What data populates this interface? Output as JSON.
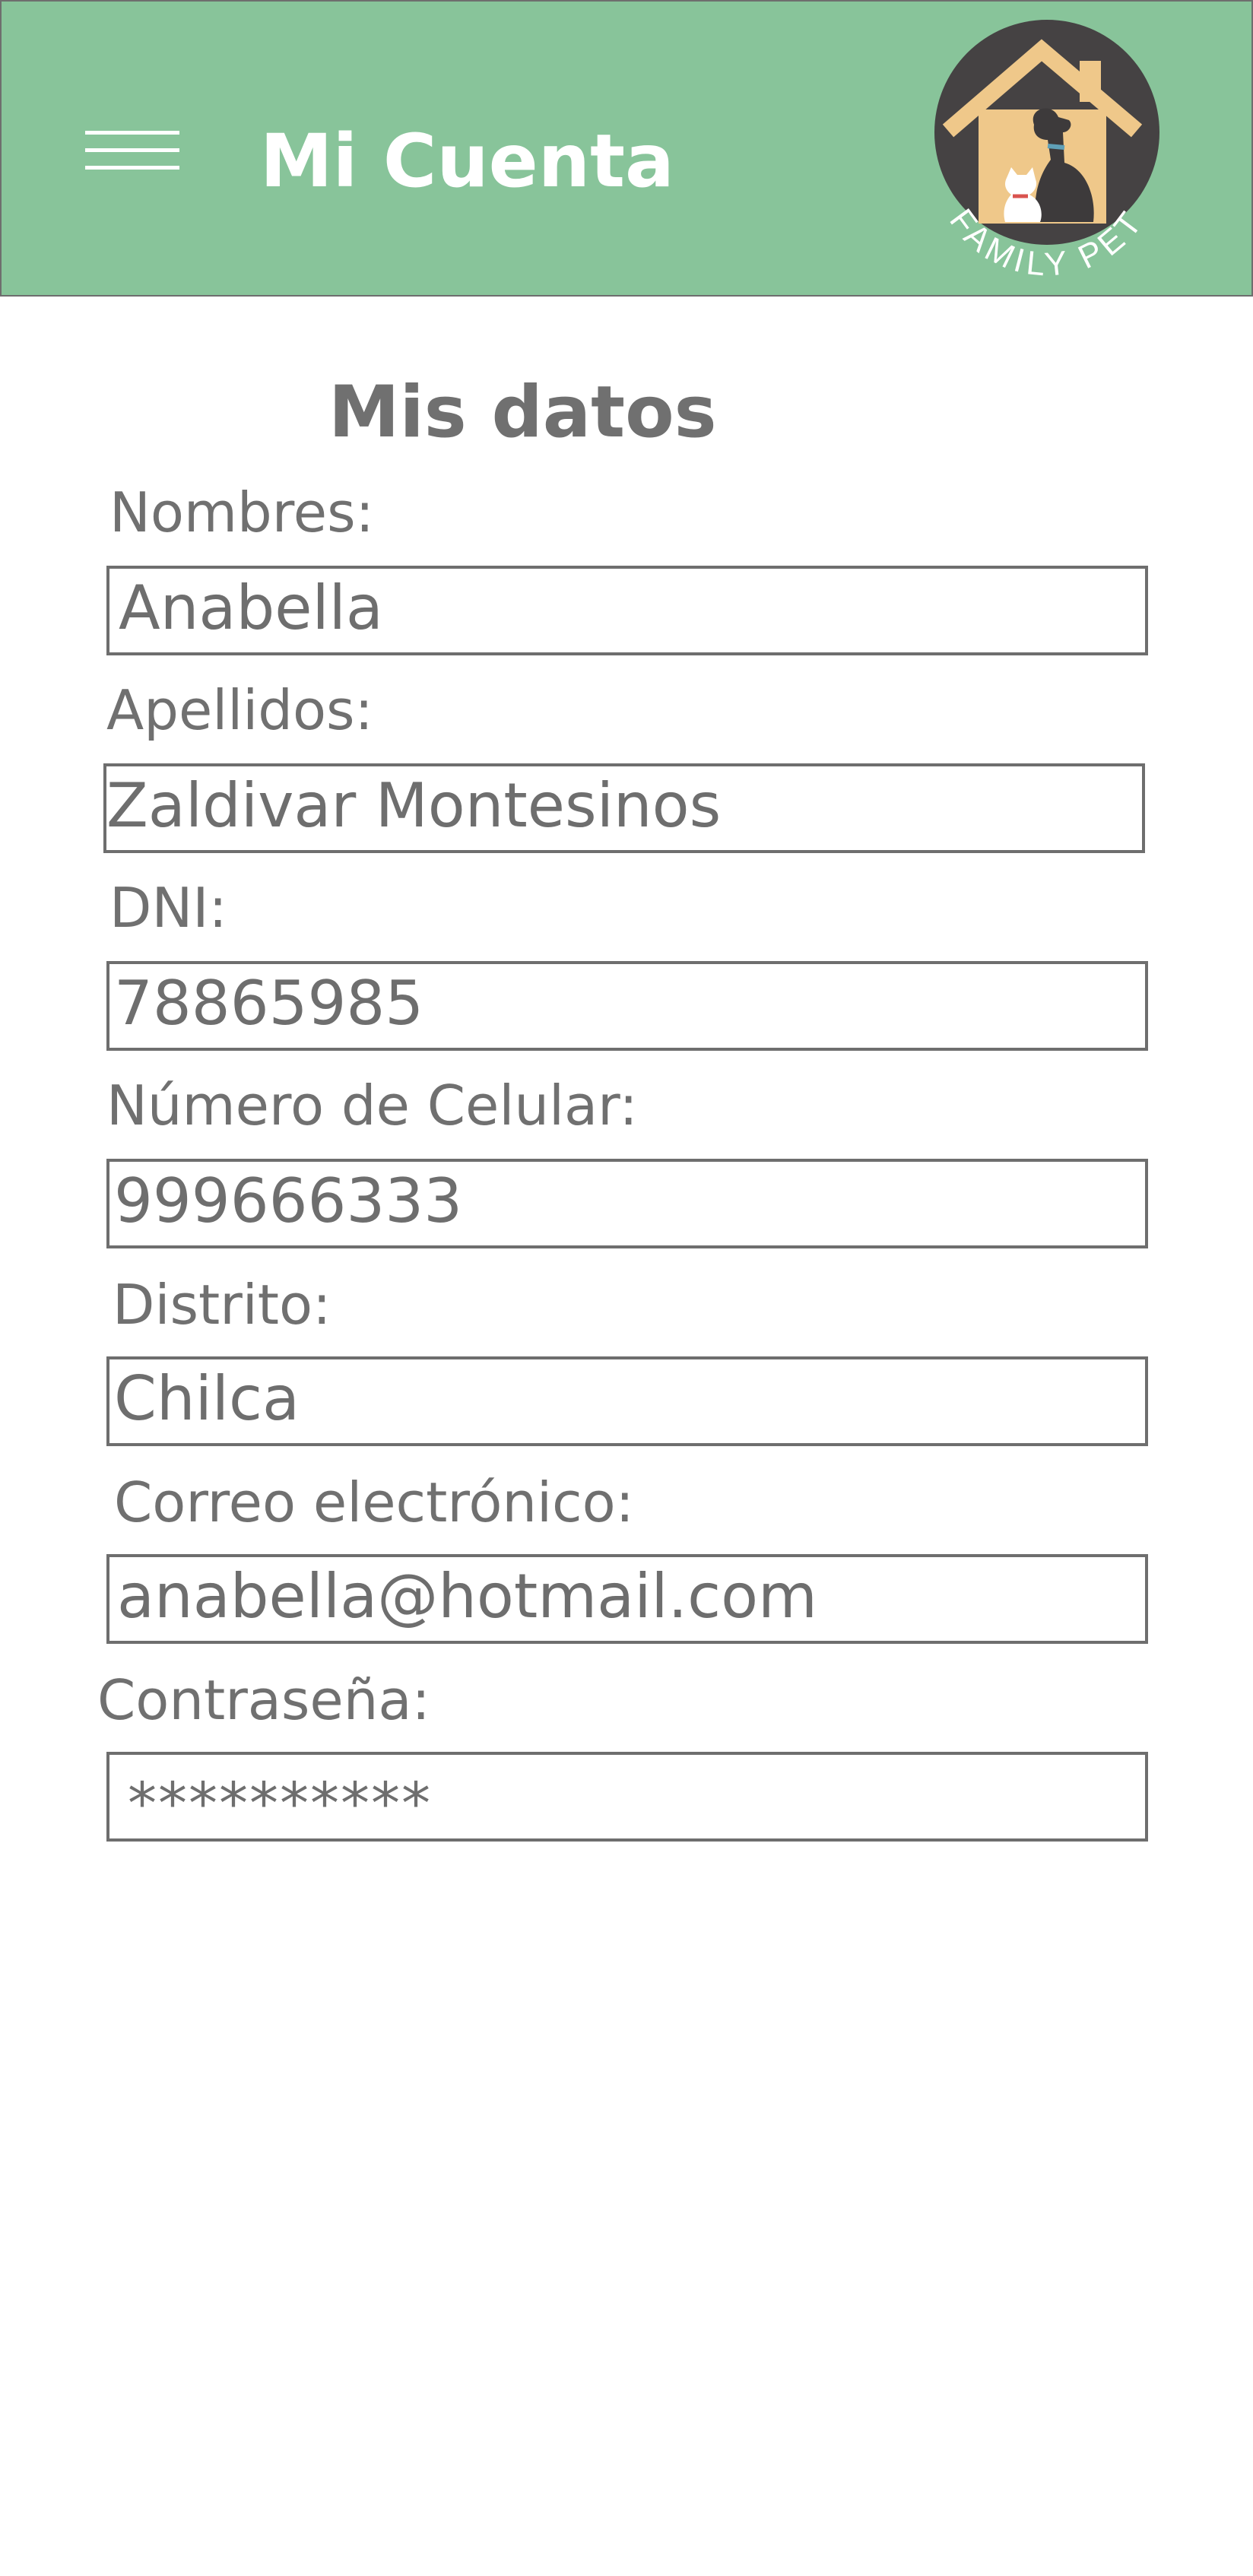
{
  "header": {
    "menu_icon": "hamburger-menu-icon",
    "title": "Mi Cuenta",
    "logo_text": "FAMILY PET",
    "accent_color": "#88c49a"
  },
  "main": {
    "section_title": "Mis datos",
    "fields": [
      {
        "label": "Nombres:",
        "value": "Anabella"
      },
      {
        "label": "Apellidos:",
        "value": "Zaldivar Montesinos"
      },
      {
        "label": "DNI:",
        "value": "78865985"
      },
      {
        "label": "Número de Celular:",
        "value": "999666333"
      },
      {
        "label": "Distrito:",
        "value": "Chilca"
      },
      {
        "label": "Correo electrónico:",
        "value": "anabella@hotmail.com"
      },
      {
        "label": "Contraseña:",
        "value": "**********"
      }
    ]
  }
}
